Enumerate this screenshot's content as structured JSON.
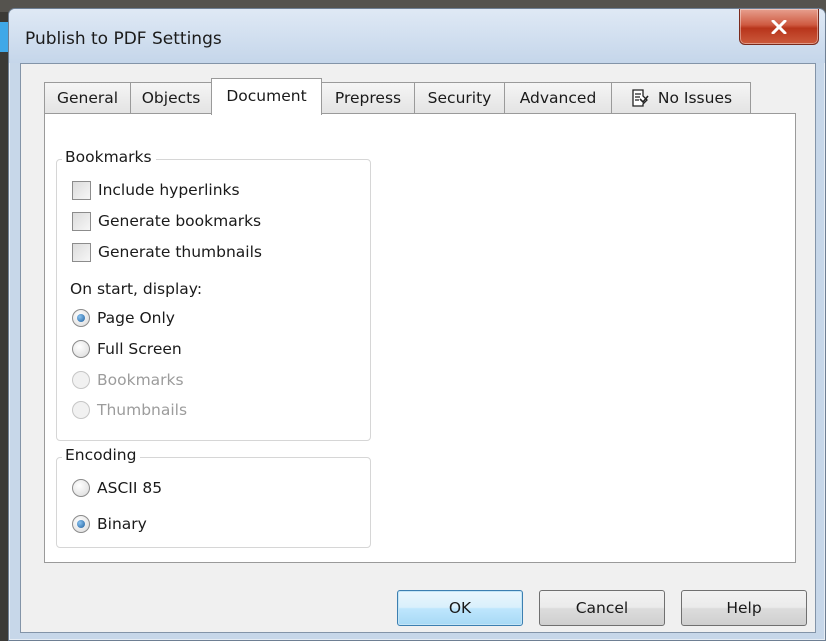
{
  "window": {
    "title": "Publish to PDF Settings"
  },
  "tabs": [
    {
      "label": "General",
      "active": false
    },
    {
      "label": "Objects",
      "active": false
    },
    {
      "label": "Document",
      "active": true
    },
    {
      "label": "Prepress",
      "active": false
    },
    {
      "label": "Security",
      "active": false
    },
    {
      "label": "Advanced",
      "active": false
    },
    {
      "label": "No Issues",
      "active": false,
      "icon": "issues-icon"
    }
  ],
  "bookmarks": {
    "group_label": "Bookmarks",
    "checkboxes": [
      {
        "label": "Include hyperlinks",
        "checked": false
      },
      {
        "label": "Generate bookmarks",
        "checked": false
      },
      {
        "label": "Generate thumbnails",
        "checked": false
      }
    ],
    "display_label": "On start, display:",
    "display_options": [
      {
        "label": "Page Only",
        "selected": true,
        "enabled": true
      },
      {
        "label": "Full Screen",
        "selected": false,
        "enabled": true
      },
      {
        "label": "Bookmarks",
        "selected": false,
        "enabled": false
      },
      {
        "label": "Thumbnails",
        "selected": false,
        "enabled": false
      }
    ]
  },
  "encoding": {
    "group_label": "Encoding",
    "options": [
      {
        "label": "ASCII 85",
        "selected": false
      },
      {
        "label": "Binary",
        "selected": true
      }
    ]
  },
  "buttons": {
    "ok": "OK",
    "cancel": "Cancel",
    "help": "Help"
  },
  "colors": {
    "titlebar": "#c7d7e9",
    "close": "#c9452a",
    "default_button": "#bee6fd"
  }
}
